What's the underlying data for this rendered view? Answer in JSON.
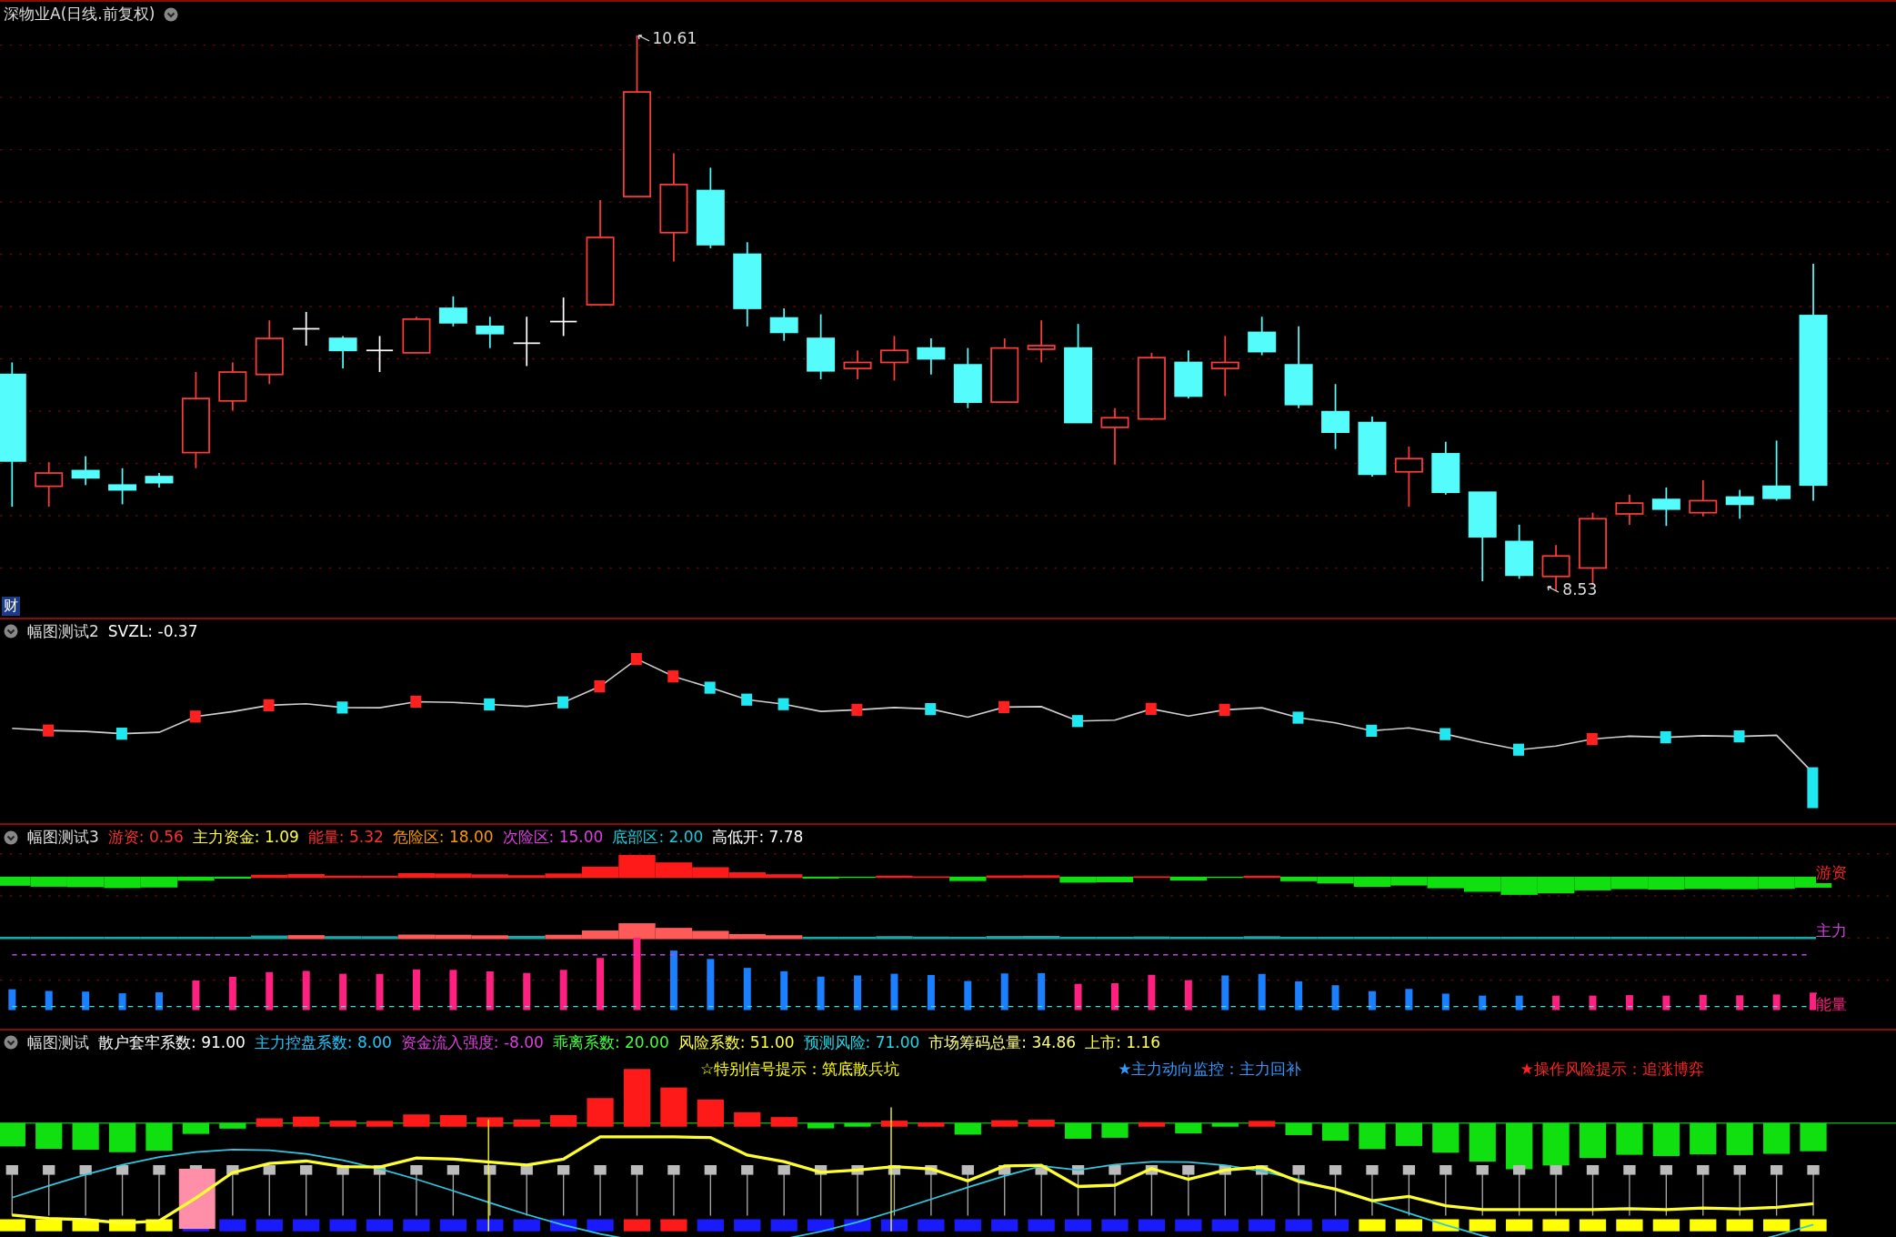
{
  "main_chart": {
    "title": "深物业A(日线.前复权)",
    "high_label": "10.61",
    "low_label": "8.53",
    "badge": "财"
  },
  "panels": [
    {
      "name": "幅图测试2",
      "readings": [
        {
          "text": "SVZL: -0.37",
          "color": "#ffffff"
        }
      ]
    },
    {
      "name": "幅图测试3",
      "readings": [
        {
          "text": "游资: 0.56",
          "color": "#ff3030"
        },
        {
          "text": "主力资金: 1.09",
          "color": "#ffff40"
        },
        {
          "text": "能量: 5.32",
          "color": "#ff3030"
        },
        {
          "text": "危险区: 18.00",
          "color": "#ff9900"
        },
        {
          "text": "次险区: 15.00",
          "color": "#e040e0"
        },
        {
          "text": "底部区: 2.00",
          "color": "#20c8d8"
        },
        {
          "text": "高低开: 7.78",
          "color": "#ffffff"
        }
      ],
      "line_labels": [
        {
          "text": "游资",
          "color": "#ff2020"
        },
        {
          "text": "主力",
          "color": "#d040e0"
        },
        {
          "text": "能量",
          "color": "#ff2080"
        }
      ]
    },
    {
      "name": "幅图测试",
      "readings": [
        {
          "text": "散户套牢系数: 91.00",
          "color": "#ffffff"
        },
        {
          "text": "主力控盘系数: 8.00",
          "color": "#20c8ff"
        },
        {
          "text": "资金流入强度: -8.00",
          "color": "#e040e0"
        },
        {
          "text": "乖离系数: 20.00",
          "color": "#40ff40"
        },
        {
          "text": "风险系数: 51.00",
          "color": "#ffff40"
        },
        {
          "text": "预测风险: 71.00",
          "color": "#20d8e8"
        },
        {
          "text": "市场筹码总量: 34.86",
          "color": "#ffff80"
        },
        {
          "text": "上市: 1.16",
          "color": "#ffff40"
        }
      ],
      "signals": [
        {
          "text": "☆特别信号提示：筑底散兵坑",
          "color": "#ffff00"
        },
        {
          "text": "★主力动向监控：主力回补",
          "color": "#3399ff"
        },
        {
          "text": "★操作风险提示：追涨博弈",
          "color": "#ff2020"
        }
      ]
    }
  ]
}
